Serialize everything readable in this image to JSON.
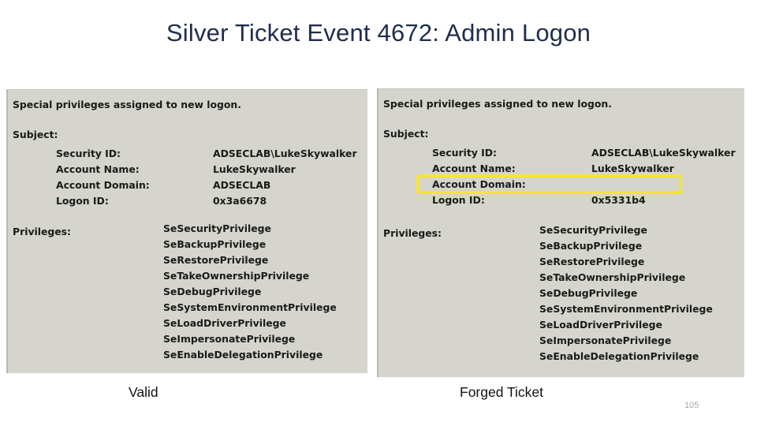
{
  "slide": {
    "title": "Silver Ticket Event 4672: Admin Logon",
    "number": "105",
    "title_color": "#1f2d4d",
    "highlight_color": "#f7e536",
    "panel_bg": "#d5d5cd"
  },
  "panels": {
    "valid": {
      "caption": "Valid",
      "headline": "Special privileges assigned to new logon.",
      "section_label": "Subject:",
      "fields": [
        {
          "label": "Security ID:",
          "value": "ADSECLAB\\LukeSkywalker"
        },
        {
          "label": "Account Name:",
          "value": "LukeSkywalker"
        },
        {
          "label": "Account Domain:",
          "value": "ADSECLAB"
        },
        {
          "label": "Logon ID:",
          "value": "0x3a6678"
        }
      ],
      "privileges_label": "Privileges:",
      "privileges": [
        "SeSecurityPrivilege",
        "SeBackupPrivilege",
        "SeRestorePrivilege",
        "SeTakeOwnershipPrivilege",
        "SeDebugPrivilege",
        "SeSystemEnvironmentPrivilege",
        "SeLoadDriverPrivilege",
        "SeImpersonatePrivilege",
        "SeEnableDelegationPrivilege"
      ]
    },
    "forged": {
      "caption": "Forged Ticket",
      "headline": "Special privileges assigned to new logon.",
      "section_label": "Subject:",
      "fields": [
        {
          "label": "Security ID:",
          "value": "ADSECLAB\\LukeSkywalker"
        },
        {
          "label": "Account Name:",
          "value": "LukeSkywalker"
        },
        {
          "label": "Account Domain:",
          "value": ""
        },
        {
          "label": "Logon ID:",
          "value": "0x5331b4"
        }
      ],
      "privileges_label": "Privileges:",
      "privileges": [
        "SeSecurityPrivilege",
        "SeBackupPrivilege",
        "SeRestorePrivilege",
        "SeTakeOwnershipPrivilege",
        "SeDebugPrivilege",
        "SeSystemEnvironmentPrivilege",
        "SeLoadDriverPrivilege",
        "SeImpersonatePrivilege",
        "SeEnableDelegationPrivilege"
      ]
    }
  }
}
